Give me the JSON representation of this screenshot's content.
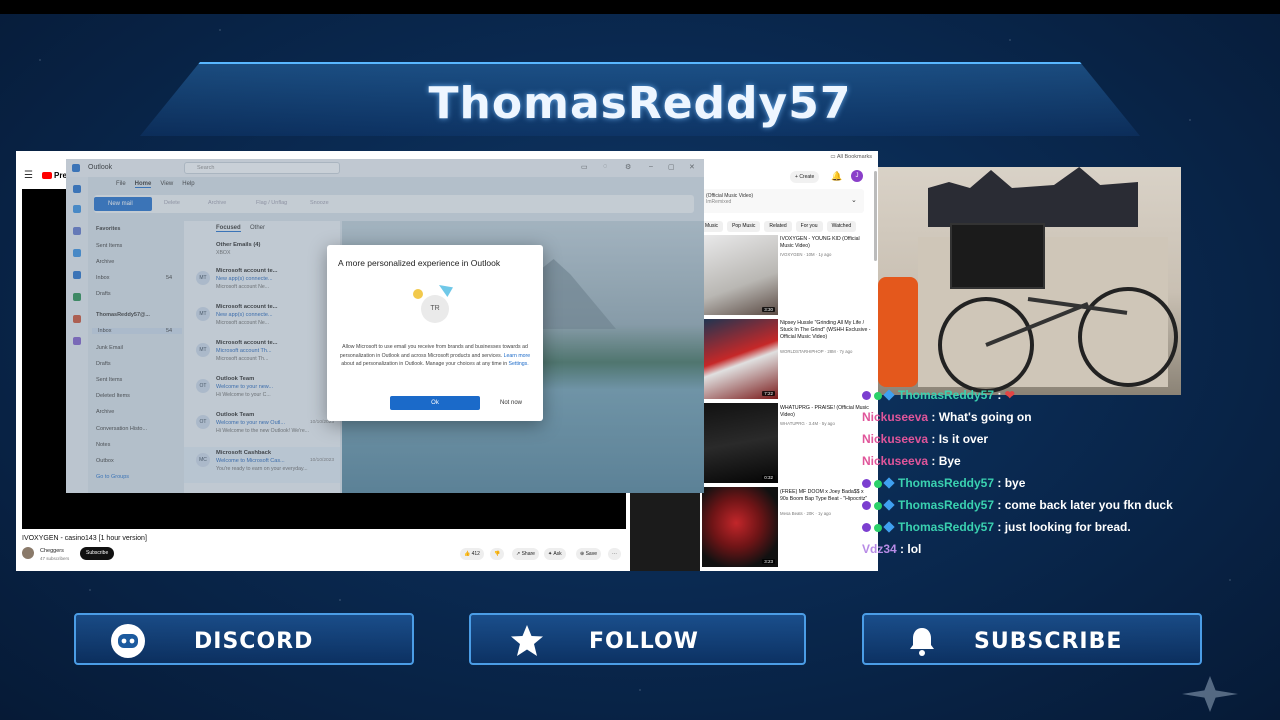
{
  "banner": {
    "title": "ThomasReddy57"
  },
  "browser": {
    "bookmarks_label": "All Bookmarks",
    "youtube_logo": "Premium",
    "create_label": "Create",
    "user_initial": "J"
  },
  "video": {
    "title": "IVOXYGEN - casino143 [1 hour version]",
    "channel": "Cheggers",
    "subscribers": "47 subscribers",
    "subscribe_label": "Subscribe",
    "likes": "412",
    "share_label": "Share",
    "ask_label": "Ask",
    "save_label": "Save"
  },
  "right_panel": {
    "playing_title": "(Official Music Video)",
    "playing_sub": "ImRemixed",
    "chips": [
      "Music",
      "Pop Music",
      "Related",
      "For you",
      "Watched"
    ],
    "recommendations": [
      {
        "title": "IVOXYGEN - YOUNG KID (Official Music Video)",
        "meta": "IVOXYGEN · 10M · 1y ago",
        "duration": "3:30"
      },
      {
        "title": "Nipsey Hussle \"Grinding All My Life / Stuck In The Grind\" (WSHH Exclusive - Official Music Video)",
        "meta": "WORLDSTARHIPHOP · 28M · 7y ago",
        "duration": "7:22"
      },
      {
        "title": "WHATUPRG - PRAISE! (Official Music Video)",
        "meta": "WHATUPRG · 3.4M · 5y ago",
        "duration": "0:32"
      },
      {
        "title": "(FREE) MF DOOM x Joey Bada$$ x 90s Boom Bap Type Beat - \"Hipocritz\"",
        "meta": "Mesa Beats · 20K · 1y ago",
        "duration": "3:23"
      }
    ]
  },
  "outlook": {
    "app_name": "Outlook",
    "search_placeholder": "Search",
    "tabs": [
      "File",
      "Home",
      "View",
      "Help"
    ],
    "new_mail": "New mail",
    "ribbon": [
      "Delete",
      "Archive",
      "Flag / Unflag",
      "Snooze"
    ],
    "favorites_label": "Favorites",
    "favorites": [
      {
        "name": "Sent Items",
        "count": ""
      },
      {
        "name": "Archive",
        "count": ""
      },
      {
        "name": "Inbox",
        "count": "54"
      },
      {
        "name": "Drafts",
        "count": ""
      }
    ],
    "account": "ThomasReddy57@...",
    "folders": [
      {
        "name": "Inbox",
        "count": "54"
      },
      {
        "name": "Junk Email",
        "count": ""
      },
      {
        "name": "Drafts",
        "count": ""
      },
      {
        "name": "Sent Items",
        "count": ""
      },
      {
        "name": "Deleted Items",
        "count": ""
      },
      {
        "name": "Archive",
        "count": ""
      },
      {
        "name": "Conversation Histo...",
        "count": ""
      },
      {
        "name": "Notes",
        "count": ""
      },
      {
        "name": "Outbox",
        "count": ""
      },
      {
        "name": "Go to Groups",
        "count": ""
      }
    ],
    "list_tabs": [
      "Focused",
      "Other"
    ],
    "messages": [
      {
        "avatar": "",
        "from": "Other Emails (4)",
        "subject": "",
        "preview": "XBOX",
        "date": ""
      },
      {
        "avatar": "MT",
        "from": "Microsoft account te...",
        "subject": "New app(s) connecte...",
        "preview": "Microsoft account Ne...",
        "date": ""
      },
      {
        "avatar": "MT",
        "from": "Microsoft account te...",
        "subject": "New app(s) connecte...",
        "preview": "Microsoft account Ne...",
        "date": ""
      },
      {
        "avatar": "MT",
        "from": "Microsoft account te...",
        "subject": "Microsoft account Th...",
        "preview": "Microsoft account Th...",
        "date": ""
      },
      {
        "avatar": "OT",
        "from": "Outlook Team",
        "subject": "Welcome to your new...",
        "preview": "Hi Welcome to your C...",
        "date": ""
      },
      {
        "avatar": "OT",
        "from": "Outlook Team",
        "subject": "Welcome to your new Outl...",
        "preview": "Hi Welcome to the new Outlook! We're...",
        "date": "10/10/2023"
      },
      {
        "avatar": "MC",
        "from": "Microsoft Cashback",
        "subject": "Welcome to Microsoft Cas...",
        "preview": "You're ready to earn on your everyday...",
        "date": "10/10/2023"
      }
    ],
    "dialog": {
      "title": "A more personalized experience in Outlook",
      "avatar": "TR",
      "body_1": "Allow Microsoft to use email you receive from brands and businesses towards ad personalization in Outlook and across Microsoft products and services.",
      "link_1": "Learn more",
      "body_2": "about ad personalization in Outlook. Manage your choices at any time in",
      "link_2": "Settings.",
      "ok": "Ok",
      "not_now": "Not now"
    }
  },
  "chat": [
    {
      "user": "ThomasReddy57",
      "msg": "",
      "color": "#3ad1b0",
      "badges": true
    },
    {
      "user": "Nickuseeva",
      "msg": "What's going on",
      "color": "#e0559a",
      "badges": false
    },
    {
      "user": "Nickuseeva",
      "msg": "Is it over",
      "color": "#e0559a",
      "badges": false
    },
    {
      "user": "Nickuseeva",
      "msg": "Bye",
      "color": "#e0559a",
      "badges": false
    },
    {
      "user": "ThomasReddy57",
      "msg": "bye",
      "color": "#3ad1b0",
      "badges": true
    },
    {
      "user": "ThomasReddy57",
      "msg": "come back later you fkn duck",
      "color": "#3ad1b0",
      "badges": true
    },
    {
      "user": "ThomasReddy57",
      "msg": "just looking for bread.",
      "color": "#3ad1b0",
      "badges": true
    },
    {
      "user": "Vdz34",
      "msg": "lol",
      "color": "#b88be6",
      "badges": false
    }
  ],
  "cta": {
    "discord": "DISCORD",
    "follow": "FOLLOW",
    "subscribe": "SUBSCRIBE"
  }
}
